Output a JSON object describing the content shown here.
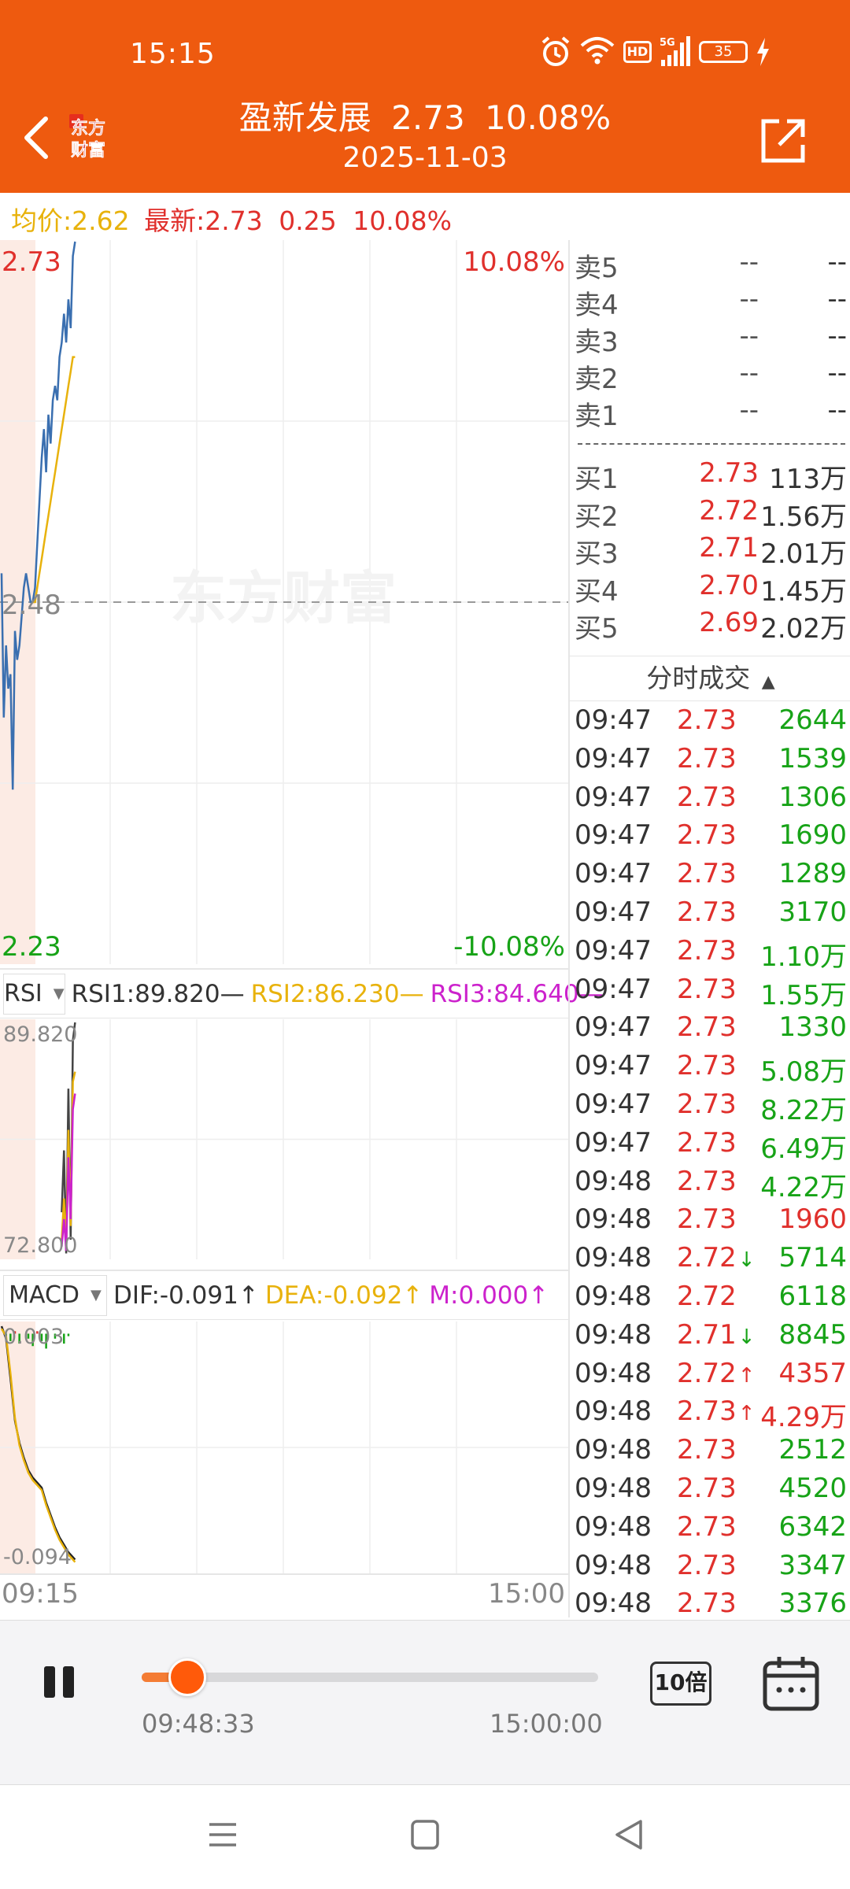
{
  "status_bar": {
    "time": "15:15",
    "battery": "35",
    "network": "5G",
    "hd_badge": "HD",
    "icons": [
      "alarm-icon",
      "wifi-icon",
      "hd-icon",
      "signal-5g-icon",
      "battery-icon",
      "charging-icon"
    ]
  },
  "header": {
    "logo_text_line1": "东方",
    "logo_text_line2": "财富",
    "stock_name": "盈新发展",
    "price": "2.73",
    "change_pct": "10.08%",
    "date": "2025-11-03",
    "bg_color": "#EE5A0F"
  },
  "info_line": {
    "avg_label": "均价:",
    "avg_value": "2.62",
    "latest_label": "最新:",
    "latest_value": "2.73",
    "change": "0.25",
    "change_pct": "10.08%"
  },
  "main_chart": {
    "price_high": "2.73",
    "price_mid": "2.48",
    "price_low": "2.23",
    "pct_high": "10.08%",
    "pct_low": "-10.08%",
    "watermark": "东方财富"
  },
  "rsi_panel": {
    "selector": "RSI",
    "rsi1": "RSI1:89.820",
    "rsi2": "RSI2:86.230",
    "rsi3": "RSI3:84.640",
    "axis_top": "89.820",
    "axis_bottom": "72.800"
  },
  "macd_panel": {
    "selector": "MACD",
    "dif": "DIF:-0.091",
    "dea": "DEA:-0.092",
    "m": "M:0.000",
    "axis_top": "0.003",
    "axis_bottom": "-0.094"
  },
  "x_axis": {
    "start": "09:15",
    "end": "15:00"
  },
  "chart_data": [
    {
      "type": "line",
      "title": "",
      "x": [
        "09:15",
        "09:16",
        "09:17",
        "09:18",
        "09:19",
        "09:20",
        "09:21",
        "09:22",
        "09:23",
        "09:24",
        "09:25",
        "09:26",
        "09:27",
        "09:28",
        "09:29",
        "09:30",
        "09:31",
        "09:32",
        "09:33",
        "09:34",
        "09:35",
        "09:36",
        "09:37",
        "09:38",
        "09:39",
        "09:40",
        "09:41",
        "09:42",
        "09:43",
        "09:44",
        "09:45",
        "09:46",
        "09:47",
        "09:48"
      ],
      "series": [
        {
          "values": [
            2.5,
            2.4,
            2.45,
            2.42,
            2.43,
            2.35,
            2.46,
            2.44,
            2.45,
            2.47,
            2.49,
            2.5,
            2.49,
            2.48,
            2.48,
            2.49,
            2.52,
            2.55,
            2.58,
            2.6,
            2.57,
            2.61,
            2.59,
            2.62,
            2.63,
            2.62,
            2.65,
            2.66,
            2.68,
            2.66,
            2.69,
            2.67,
            2.72,
            2.73
          ],
          "color": "#3A6FB0"
        },
        {
          "values": [
            null,
            null,
            null,
            null,
            null,
            null,
            null,
            null,
            null,
            null,
            null,
            null,
            null,
            null,
            2.48,
            2.48,
            2.49,
            2.5,
            2.51,
            2.52,
            2.53,
            2.54,
            2.55,
            2.56,
            2.57,
            2.58,
            2.59,
            2.6,
            2.61,
            2.62,
            2.63,
            2.64,
            2.65,
            2.65
          ],
          "color": "#E8B20C"
        }
      ],
      "ylim": [
        2.23,
        2.73
      ],
      "xlim": [
        "09:15",
        "15:00"
      ],
      "prev_close": 2.48,
      "grid": true
    },
    {
      "type": "line",
      "title": "RSI",
      "x": [
        "09:42",
        "09:43",
        "09:44",
        "09:45",
        "09:46",
        "09:47",
        "09:48"
      ],
      "series": [
        {
          "name": "RSI1",
          "values": [
            76.0,
            80.5,
            73.0,
            85.0,
            74.0,
            88.5,
            89.82
          ],
          "color": "#444444"
        },
        {
          "name": "RSI2",
          "values": [
            74.0,
            77.0,
            73.5,
            82.0,
            75.0,
            85.5,
            86.23
          ],
          "color": "#E8B20C"
        },
        {
          "name": "RSI3",
          "values": [
            73.5,
            75.5,
            73.2,
            80.0,
            75.5,
            83.5,
            84.64
          ],
          "color": "#CC22CC"
        }
      ],
      "ylim": [
        72.8,
        89.82
      ],
      "xlim": [
        "09:15",
        "15:00"
      ]
    },
    {
      "type": "line",
      "title": "MACD",
      "x": [
        "09:15",
        "09:17",
        "09:19",
        "09:21",
        "09:23",
        "09:25",
        "09:27",
        "09:29",
        "09:31",
        "09:33",
        "09:35",
        "09:37",
        "09:39",
        "09:41",
        "09:43",
        "09:45",
        "09:47",
        "09:48"
      ],
      "series": [
        {
          "name": "DIF",
          "values": [
            0.003,
            -0.002,
            -0.018,
            -0.035,
            -0.044,
            -0.05,
            -0.055,
            -0.058,
            -0.06,
            -0.062,
            -0.068,
            -0.073,
            -0.078,
            -0.082,
            -0.085,
            -0.088,
            -0.09,
            -0.091
          ],
          "color": "#222222"
        },
        {
          "name": "DEA",
          "values": [
            0.002,
            -0.001,
            -0.016,
            -0.034,
            -0.045,
            -0.051,
            -0.056,
            -0.059,
            -0.061,
            -0.063,
            -0.069,
            -0.074,
            -0.079,
            -0.083,
            -0.086,
            -0.089,
            -0.091,
            -0.092
          ],
          "color": "#E8B20C"
        }
      ],
      "bars": {
        "name": "M",
        "values": [
          0.0,
          -0.002,
          -0.003,
          0.001,
          -0.004,
          0.0,
          -0.002,
          -0.005,
          0.001,
          -0.003,
          -0.006,
          0.0,
          -0.002,
          0.0,
          -0.004,
          -0.001,
          0.0,
          0.0
        ]
      },
      "ylim": [
        -0.094,
        0.003
      ],
      "xlim": [
        "09:15",
        "15:00"
      ]
    }
  ],
  "order_book": {
    "sell": [
      {
        "label": "卖5",
        "price": "--",
        "vol": "--"
      },
      {
        "label": "卖4",
        "price": "--",
        "vol": "--"
      },
      {
        "label": "卖3",
        "price": "--",
        "vol": "--"
      },
      {
        "label": "卖2",
        "price": "--",
        "vol": "--"
      },
      {
        "label": "卖1",
        "price": "--",
        "vol": "--"
      }
    ],
    "buy": [
      {
        "label": "买1",
        "price": "2.73",
        "vol": "113万"
      },
      {
        "label": "买2",
        "price": "2.72",
        "vol": "1.56万"
      },
      {
        "label": "买3",
        "price": "2.71",
        "vol": "2.01万"
      },
      {
        "label": "买4",
        "price": "2.70",
        "vol": "1.45万"
      },
      {
        "label": "买5",
        "price": "2.69",
        "vol": "2.02万"
      }
    ]
  },
  "ticks": {
    "header": "分时成交",
    "rows": [
      {
        "time": "09:47",
        "price": "2.73",
        "arrow": "",
        "vol": "2644",
        "vol_color": "green"
      },
      {
        "time": "09:47",
        "price": "2.73",
        "arrow": "",
        "vol": "1539",
        "vol_color": "green"
      },
      {
        "time": "09:47",
        "price": "2.73",
        "arrow": "",
        "vol": "1306",
        "vol_color": "green"
      },
      {
        "time": "09:47",
        "price": "2.73",
        "arrow": "",
        "vol": "1690",
        "vol_color": "green"
      },
      {
        "time": "09:47",
        "price": "2.73",
        "arrow": "",
        "vol": "1289",
        "vol_color": "green"
      },
      {
        "time": "09:47",
        "price": "2.73",
        "arrow": "",
        "vol": "3170",
        "vol_color": "green"
      },
      {
        "time": "09:47",
        "price": "2.73",
        "arrow": "",
        "vol": "1.10万",
        "vol_color": "green"
      },
      {
        "time": "09:47",
        "price": "2.73",
        "arrow": "",
        "vol": "1.55万",
        "vol_color": "green"
      },
      {
        "time": "09:47",
        "price": "2.73",
        "arrow": "",
        "vol": "1330",
        "vol_color": "green"
      },
      {
        "time": "09:47",
        "price": "2.73",
        "arrow": "",
        "vol": "5.08万",
        "vol_color": "green"
      },
      {
        "time": "09:47",
        "price": "2.73",
        "arrow": "",
        "vol": "8.22万",
        "vol_color": "green"
      },
      {
        "time": "09:47",
        "price": "2.73",
        "arrow": "",
        "vol": "6.49万",
        "vol_color": "green"
      },
      {
        "time": "09:48",
        "price": "2.73",
        "arrow": "",
        "vol": "4.22万",
        "vol_color": "green"
      },
      {
        "time": "09:48",
        "price": "2.73",
        "arrow": "",
        "vol": "1960",
        "vol_color": "red"
      },
      {
        "time": "09:48",
        "price": "2.72",
        "arrow": "↓",
        "vol": "5714",
        "vol_color": "green"
      },
      {
        "time": "09:48",
        "price": "2.72",
        "arrow": "",
        "vol": "6118",
        "vol_color": "green"
      },
      {
        "time": "09:48",
        "price": "2.71",
        "arrow": "↓",
        "vol": "8845",
        "vol_color": "green"
      },
      {
        "time": "09:48",
        "price": "2.72",
        "arrow": "↑",
        "vol": "4357",
        "vol_color": "red"
      },
      {
        "time": "09:48",
        "price": "2.73",
        "arrow": "↑",
        "vol": "4.29万",
        "vol_color": "red"
      },
      {
        "time": "09:48",
        "price": "2.73",
        "arrow": "",
        "vol": "2512",
        "vol_color": "green"
      },
      {
        "time": "09:48",
        "price": "2.73",
        "arrow": "",
        "vol": "4520",
        "vol_color": "green"
      },
      {
        "time": "09:48",
        "price": "2.73",
        "arrow": "",
        "vol": "6342",
        "vol_color": "green"
      },
      {
        "time": "09:48",
        "price": "2.73",
        "arrow": "",
        "vol": "3347",
        "vol_color": "green"
      },
      {
        "time": "09:48",
        "price": "2.73",
        "arrow": "",
        "vol": "3376",
        "vol_color": "green"
      }
    ]
  },
  "player": {
    "current_time": "09:48:33",
    "end_time": "15:00:00",
    "progress_fraction": 0.1,
    "speed": "10倍",
    "accent_color": "#FF5A0A"
  },
  "nav_bar": {
    "icons": [
      "menu-icon",
      "home-icon",
      "back-icon"
    ]
  }
}
